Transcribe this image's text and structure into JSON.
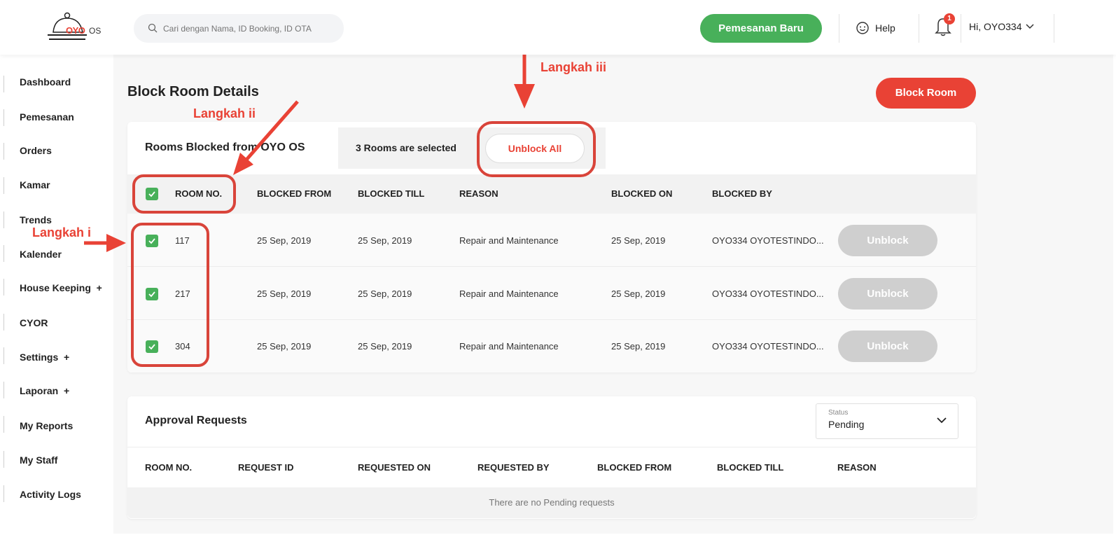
{
  "header": {
    "logo_brand": "OYO",
    "logo_os": "OS",
    "search_placeholder": "Cari dengan Nama, ID Booking, ID OTA",
    "new_booking": "Pemesanan Baru",
    "help": "Help",
    "notifications": "1",
    "user": "Hi, OYO334"
  },
  "sidebar": {
    "items": [
      {
        "label": "Dashboard"
      },
      {
        "label": "Pemesanan"
      },
      {
        "label": "Orders"
      },
      {
        "label": "Kamar"
      },
      {
        "label": "Trends"
      },
      {
        "label": "Kalender"
      },
      {
        "label": "House Keeping  +"
      },
      {
        "label": "CYOR"
      },
      {
        "label": "Settings  +"
      },
      {
        "label": "Laporan  +"
      },
      {
        "label": "My Reports"
      },
      {
        "label": "My Staff"
      },
      {
        "label": "Activity Logs"
      }
    ]
  },
  "page": {
    "title": "Block Room Details",
    "block_room_button": "Block Room"
  },
  "blocked": {
    "title": "Rooms Blocked from OYO OS",
    "selected_text": "3 Rooms are selected",
    "unblock_all": "Unblock All",
    "columns": [
      "ROOM NO.",
      "BLOCKED FROM",
      "BLOCKED TILL",
      "REASON",
      "BLOCKED ON",
      "BLOCKED BY"
    ],
    "unblock_label": "Unblock",
    "rows": [
      {
        "room": "117",
        "from": "25 Sep, 2019",
        "till": "25 Sep, 2019",
        "reason": "Repair and Maintenance",
        "on": "25 Sep, 2019",
        "by": "OYO334 OYOTESTINDO..."
      },
      {
        "room": "217",
        "from": "25 Sep, 2019",
        "till": "25 Sep, 2019",
        "reason": "Repair and Maintenance",
        "on": "25 Sep, 2019",
        "by": "OYO334 OYOTESTINDO..."
      },
      {
        "room": "304",
        "from": "25 Sep, 2019",
        "till": "25 Sep, 2019",
        "reason": "Repair and Maintenance",
        "on": "25 Sep, 2019",
        "by": "OYO334 OYOTESTINDO..."
      }
    ]
  },
  "approval": {
    "title": "Approval Requests",
    "status_label": "Status",
    "status_value": "Pending",
    "columns": [
      "ROOM NO.",
      "REQUEST ID",
      "REQUESTED ON",
      "REQUESTED BY",
      "BLOCKED FROM",
      "BLOCKED TILL",
      "REASON"
    ],
    "empty": "There are no Pending requests"
  },
  "annotations": {
    "step1": "Langkah i",
    "step2": "Langkah ii",
    "step3": "Langkah iii",
    "color": "#e94235"
  },
  "colors": {
    "accent_green": "#48b05a",
    "accent_red": "#e94235",
    "disabled_gray": "#cfcfcf"
  }
}
